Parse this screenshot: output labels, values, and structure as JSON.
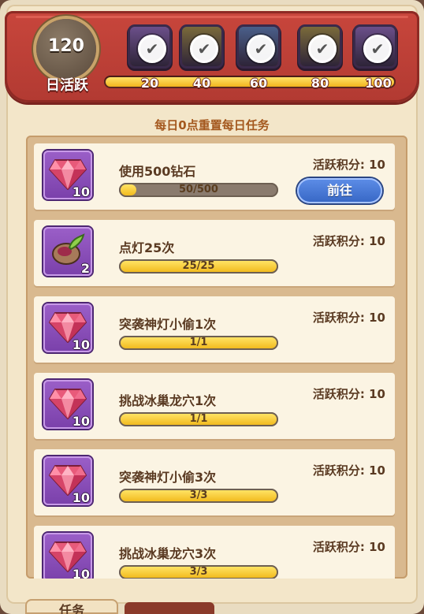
{
  "header": {
    "activity_points": "120",
    "activity_label": "日活跃",
    "progress_fraction": 1.0,
    "milestones": [
      "20",
      "40",
      "60",
      "80",
      "100"
    ],
    "chests": [
      {
        "color": "#6b4f8a",
        "claimed": true
      },
      {
        "color": "#7a6a3a",
        "claimed": true
      },
      {
        "color": "#4a5f8a",
        "claimed": true
      },
      {
        "color": "#7a6a3a",
        "claimed": true
      },
      {
        "color": "#6b4f8a",
        "claimed": true
      }
    ]
  },
  "reset_note": "每日0点重置每日任务",
  "tasks": [
    {
      "name": "使用500钻石",
      "progress_text": "50/500",
      "progress": 0.1,
      "points_label": "活跃积分: 10",
      "icon": "gem-icon",
      "qty": "10",
      "button": "前往"
    },
    {
      "name": "点灯25次",
      "progress_text": "25/25",
      "progress": 1.0,
      "points_label": "活跃积分: 10",
      "icon": "lamp-seed-icon",
      "qty": "2"
    },
    {
      "name": "突袭神灯小偷1次",
      "progress_text": "1/1",
      "progress": 1.0,
      "points_label": "活跃积分: 10",
      "icon": "gem-icon",
      "qty": "10"
    },
    {
      "name": "挑战冰巢龙穴1次",
      "progress_text": "1/1",
      "progress": 1.0,
      "points_label": "活跃积分: 10",
      "icon": "gem-icon",
      "qty": "10"
    },
    {
      "name": "突袭神灯小偷3次",
      "progress_text": "3/3",
      "progress": 1.0,
      "points_label": "活跃积分: 10",
      "icon": "gem-icon",
      "qty": "10"
    },
    {
      "name": "挑战冰巢龙穴3次",
      "progress_text": "3/3",
      "progress": 1.0,
      "points_label": "活跃积分: 10",
      "icon": "gem-icon",
      "qty": "10"
    }
  ],
  "bottom_tab": "任务"
}
